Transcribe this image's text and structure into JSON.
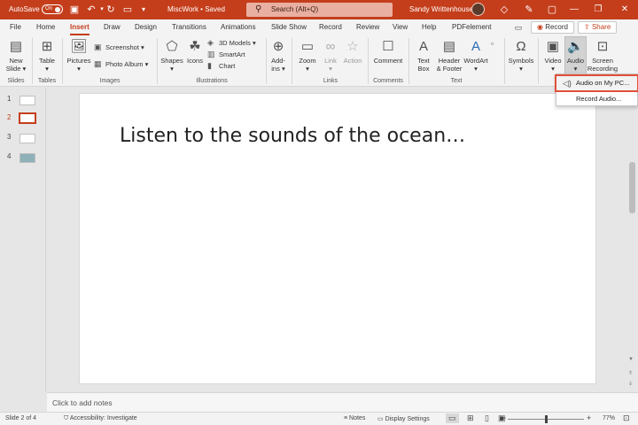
{
  "titlebar": {
    "autosave_label": "AutoSave",
    "autosave_toggle": "On",
    "doc_title": "MiscWork • Saved",
    "search_placeholder": "Search (Alt+Q)",
    "user_name": "Sandy Writtenhouse"
  },
  "tabs": [
    "File",
    "Home",
    "Insert",
    "Draw",
    "Design",
    "Transitions",
    "Animations",
    "Slide Show",
    "Record",
    "Review",
    "View",
    "Help",
    "PDFelement"
  ],
  "active_tab": "Insert",
  "tab_actions": {
    "record": "Record",
    "share": "Share"
  },
  "ribbon": {
    "new_slide": [
      "New",
      "Slide"
    ],
    "table": "Table",
    "pictures": "Pictures",
    "screenshot": "Screenshot",
    "photo_album": "Photo Album",
    "shapes": "Shapes",
    "icons": "Icons",
    "models3d": "3D Models",
    "smartart": "SmartArt",
    "chart": "Chart",
    "addins": [
      "Add-",
      "ins"
    ],
    "zoom": "Zoom",
    "link": "Link",
    "action": "Action",
    "comment": "Comment",
    "textbox": [
      "Text",
      "Box"
    ],
    "header_footer": [
      "Header",
      "& Footer"
    ],
    "wordart": "WordArt",
    "symbols": "Symbols",
    "video": "Video",
    "audio": "Audio",
    "screen_recording": [
      "Screen",
      "Recording"
    ]
  },
  "groups": [
    "Slides",
    "Tables",
    "Images",
    "Illustrations",
    "Links",
    "Comments",
    "Text"
  ],
  "audio_menu": {
    "items": [
      "Audio on My PC...",
      "Record Audio..."
    ]
  },
  "slides": {
    "numbers": [
      "1",
      "2",
      "3",
      "4"
    ],
    "selected": 2
  },
  "slide": {
    "title": "Listen to the sounds of the ocean…"
  },
  "notes": {
    "placeholder": "Click to add notes"
  },
  "status": {
    "slide_info": "Slide 2 of 4",
    "accessibility": "Accessibility: Investigate",
    "notes": "Notes",
    "display_settings": "Display Settings",
    "zoom": "77%",
    "zoom_level": 0.5
  },
  "colors": {
    "accent": "#c43e1c",
    "highlight": "#e0503a"
  }
}
